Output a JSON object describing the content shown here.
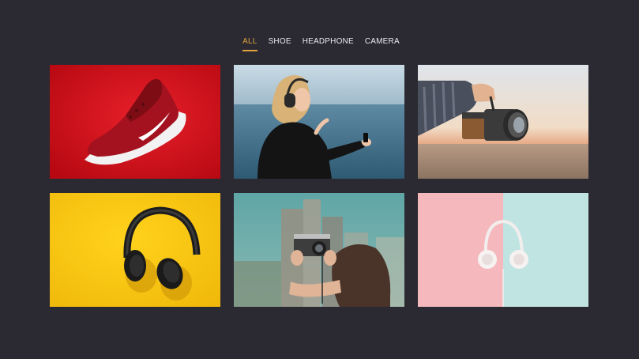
{
  "filters": [
    {
      "label": "ALL",
      "active": true
    },
    {
      "label": "SHOE",
      "active": false
    },
    {
      "label": "HEADPHONE",
      "active": false
    },
    {
      "label": "CAMERA",
      "active": false
    }
  ],
  "colors": {
    "background": "#2b2a33",
    "accent": "#e0a23c",
    "nav_text": "#e8e8ee"
  },
  "gallery": [
    {
      "subject": "red sneaker on red background",
      "category": "SHOE"
    },
    {
      "subject": "woman with headphones by the sea",
      "category": "HEADPHONE"
    },
    {
      "subject": "hand holding vintage camera over landscape",
      "category": "CAMERA"
    },
    {
      "subject": "black headphones on yellow background",
      "category": "HEADPHONE"
    },
    {
      "subject": "person photographing city with camera",
      "category": "CAMERA"
    },
    {
      "subject": "white headphones on pink and mint background",
      "category": "HEADPHONE"
    }
  ]
}
